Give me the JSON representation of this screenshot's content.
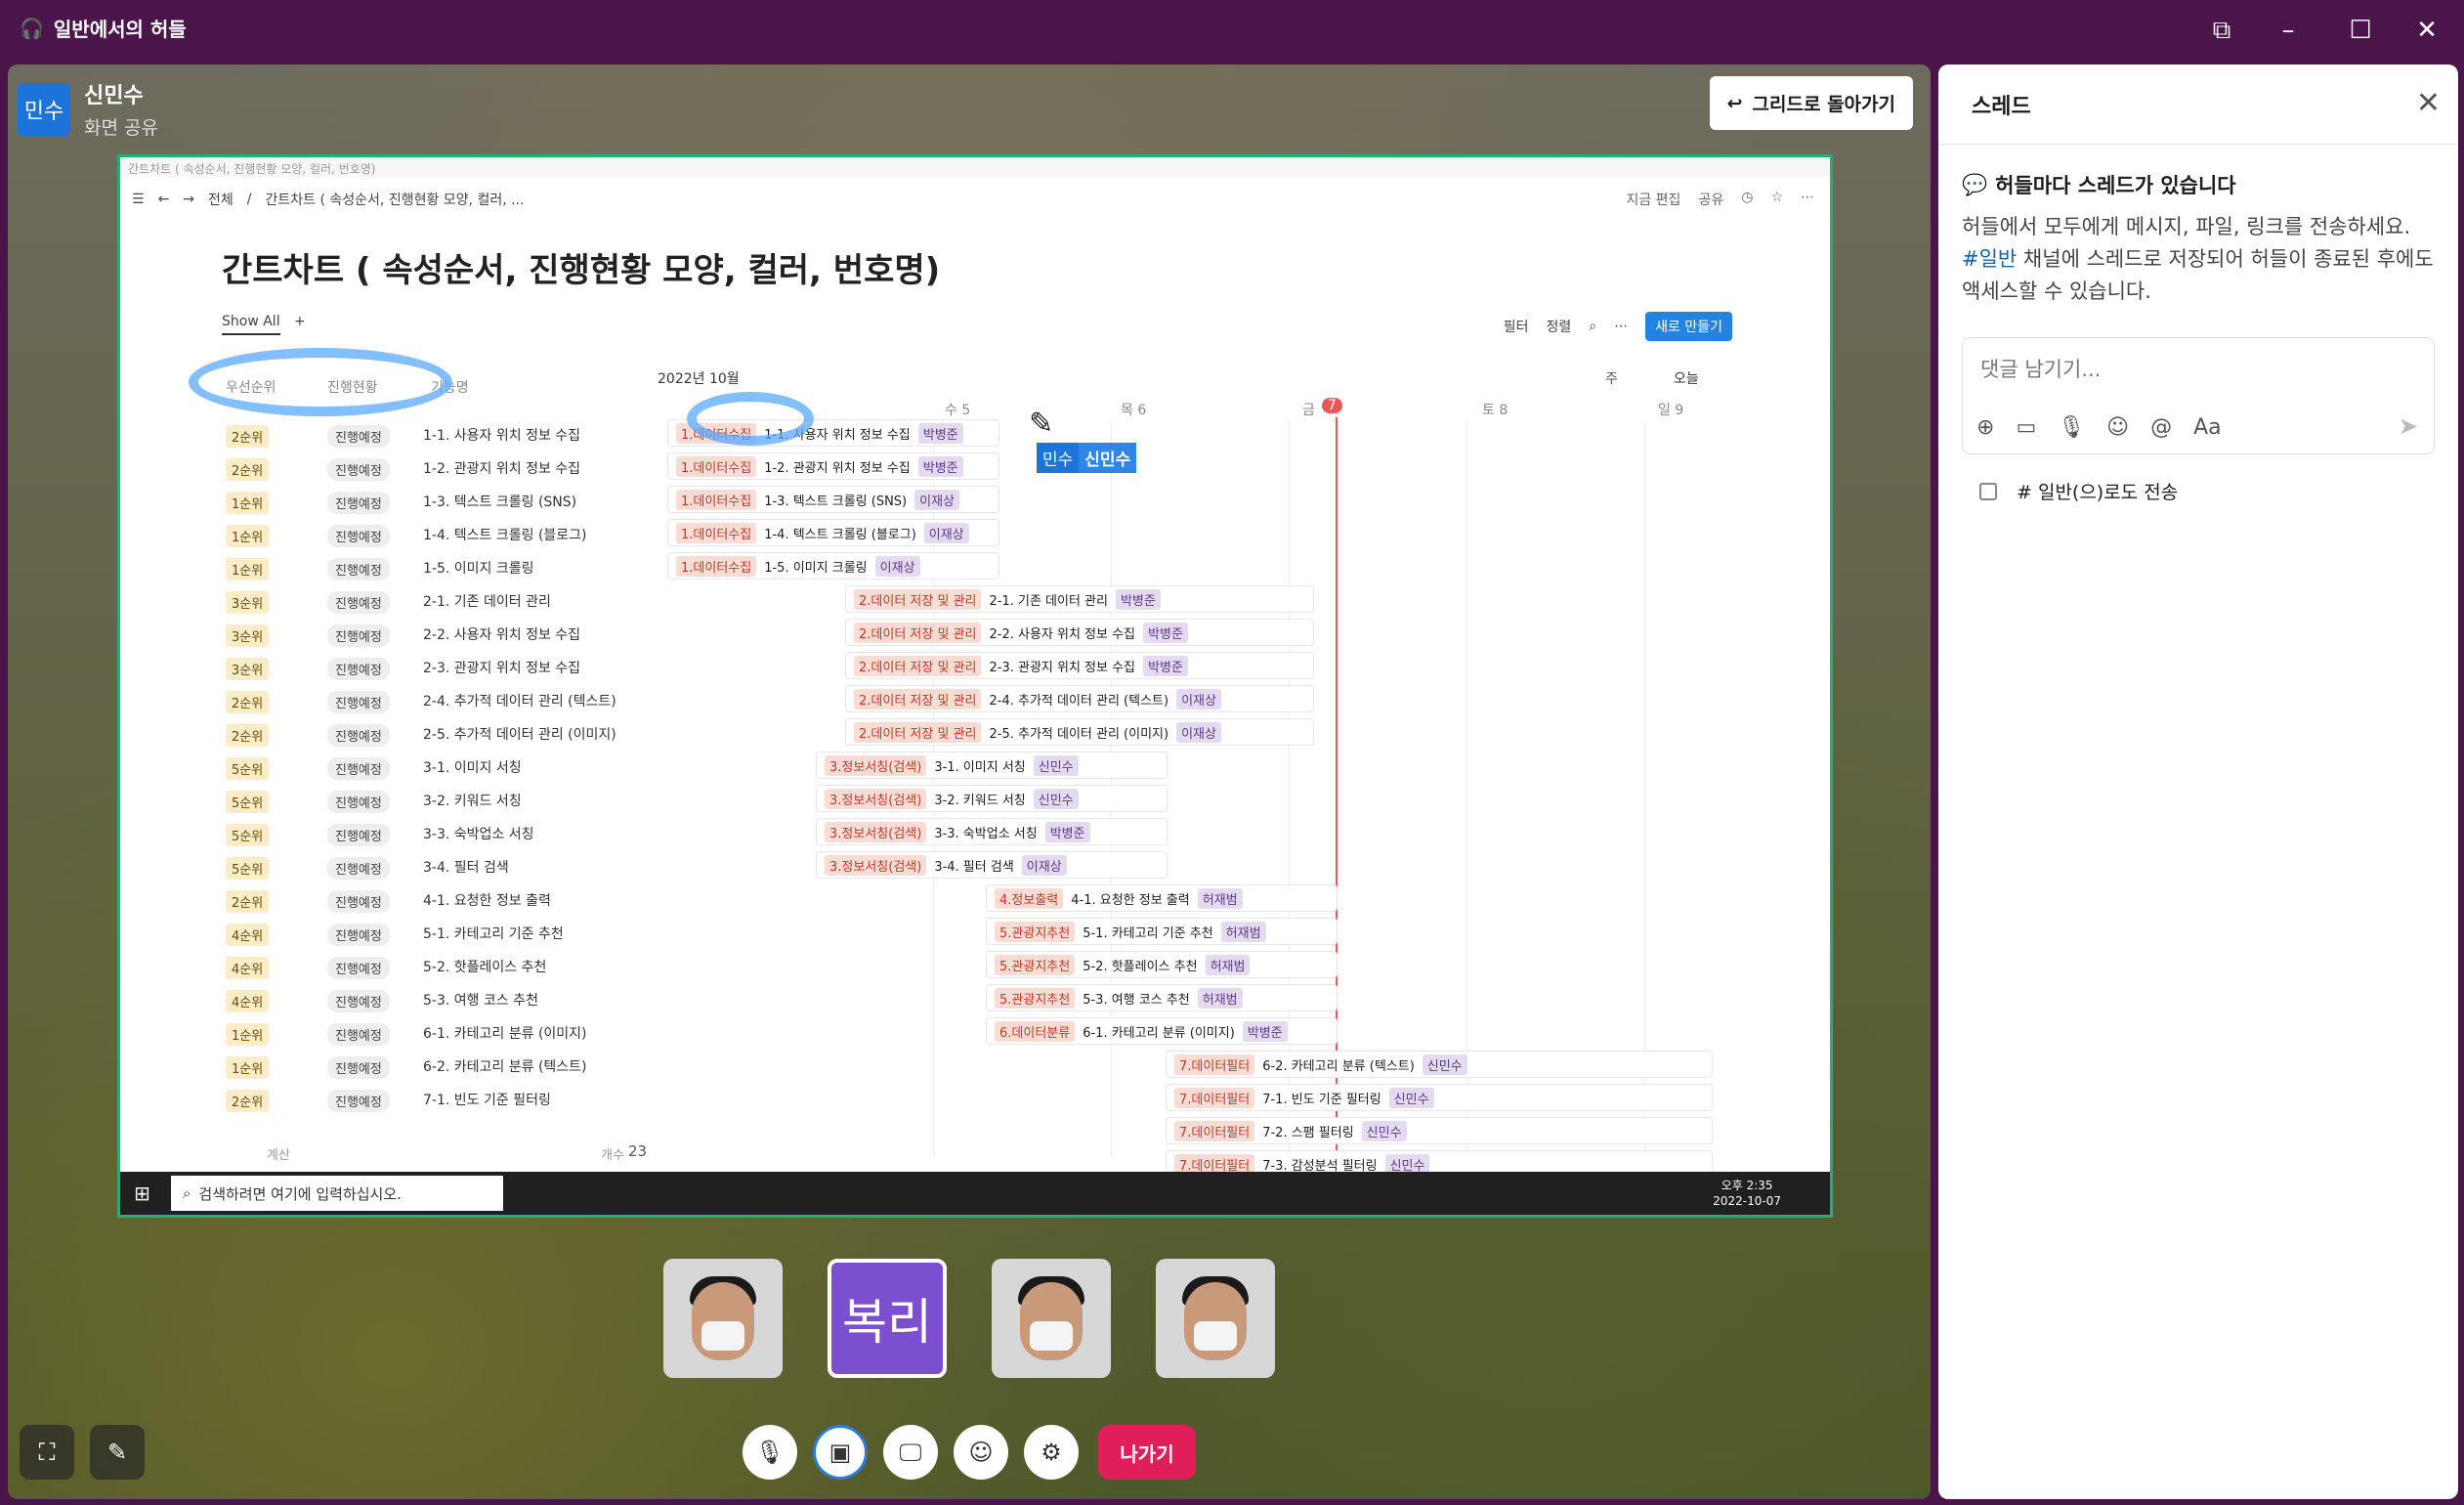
{
  "window": {
    "title": "일반에서의 허들"
  },
  "presenter": {
    "avatar_text": "민수",
    "name": "신민수",
    "status": "화면 공유"
  },
  "back_button": {
    "label": "그리드로 돌아가기"
  },
  "screen": {
    "window_title": "간트차트 ( 속성순서, 진행현황 모양, 컬러, 번호명)",
    "breadcrumb": [
      "전체",
      "간트차트 ( 속성순서, 진행현황 모양, 컬러, ..."
    ],
    "top_actions": [
      "지금 편집",
      "공유"
    ],
    "page_title": "간트차트 ( 속성순서, 진행현황 모양, 컬러, 번호명)",
    "view_tab": "Show All",
    "view_actions": [
      "필터",
      "정렬"
    ],
    "new_button": "새로 만들기",
    "columns": [
      "우선순위",
      "진행현황",
      "기능명"
    ],
    "month": "2022년 10월",
    "nav": {
      "today": "오늘",
      "mode": "주"
    },
    "days": [
      "수 5",
      "목 6",
      "금",
      "토 8",
      "일 9"
    ],
    "today_day": "7",
    "rows": [
      {
        "pri": "2순위",
        "stat": "진행예정",
        "name": "1-1. 사용자 위치 정보 수집",
        "cat": "1.데이터수집",
        "own": "박병준"
      },
      {
        "pri": "2순위",
        "stat": "진행예정",
        "name": "1-2. 관광지 위치 정보 수집",
        "cat": "1.데이터수집",
        "own": "박병준"
      },
      {
        "pri": "1순위",
        "stat": "진행예정",
        "name": "1-3. 텍스트 크롤링 (SNS)",
        "cat": "1.데이터수집",
        "own": "이재상"
      },
      {
        "pri": "1순위",
        "stat": "진행예정",
        "name": "1-4. 텍스트 크롤링 (블로그)",
        "cat": "1.데이터수집",
        "own": "이재상"
      },
      {
        "pri": "1순위",
        "stat": "진행예정",
        "name": "1-5. 이미지 크롤링",
        "cat": "1.데이터수집",
        "own": "이재상"
      },
      {
        "pri": "3순위",
        "stat": "진행예정",
        "name": "2-1. 기존 데이터 관리",
        "cat": "2.데이터 저장 및 관리",
        "own": "박병준"
      },
      {
        "pri": "3순위",
        "stat": "진행예정",
        "name": "2-2. 사용자 위치 정보 수집",
        "cat": "2.데이터 저장 및 관리",
        "own": "박병준"
      },
      {
        "pri": "3순위",
        "stat": "진행예정",
        "name": "2-3. 관광지 위치 정보 수집",
        "cat": "2.데이터 저장 및 관리",
        "own": "박병준"
      },
      {
        "pri": "2순위",
        "stat": "진행예정",
        "name": "2-4. 추가적 데이터 관리 (텍스트)",
        "cat": "2.데이터 저장 및 관리",
        "own": "이재상"
      },
      {
        "pri": "2순위",
        "stat": "진행예정",
        "name": "2-5. 추가적 데이터 관리 (이미지)",
        "cat": "2.데이터 저장 및 관리",
        "own": "이재상"
      },
      {
        "pri": "5순위",
        "stat": "진행예정",
        "name": "3-1. 이미지 서칭",
        "cat": "3.정보서칭(검색)",
        "own": "신민수"
      },
      {
        "pri": "5순위",
        "stat": "진행예정",
        "name": "3-2. 키워드 서칭",
        "cat": "3.정보서칭(검색)",
        "own": "신민수"
      },
      {
        "pri": "5순위",
        "stat": "진행예정",
        "name": "3-3. 숙박업소 서칭",
        "cat": "3.정보서칭(검색)",
        "own": "박병준"
      },
      {
        "pri": "5순위",
        "stat": "진행예정",
        "name": "3-4. 필터 검색",
        "cat": "3.정보서칭(검색)",
        "own": "이재상"
      },
      {
        "pri": "2순위",
        "stat": "진행예정",
        "name": "4-1. 요청한 정보 출력",
        "cat": "4.정보출력",
        "own": "허재범"
      },
      {
        "pri": "4순위",
        "stat": "진행예정",
        "name": "5-1. 카테고리 기준 추천",
        "cat": "5.관광지추천",
        "own": "허재범"
      },
      {
        "pri": "4순위",
        "stat": "진행예정",
        "name": "5-2. 핫플레이스 추천",
        "cat": "5.관광지추천",
        "own": "허재범"
      },
      {
        "pri": "4순위",
        "stat": "진행예정",
        "name": "5-3. 여행 코스 추천",
        "cat": "5.관광지추천",
        "own": "허재범"
      },
      {
        "pri": "1순위",
        "stat": "진행예정",
        "name": "6-1. 카테고리 분류 (이미지)",
        "cat": "6.데이터분류",
        "own": "박병준"
      },
      {
        "pri": "1순위",
        "stat": "진행예정",
        "name": "6-2. 카테고리 분류 (텍스트)",
        "cat": "7.데이터필터",
        "own": "신민수"
      },
      {
        "pri": "2순위",
        "stat": "진행예정",
        "name": "7-1. 빈도 기준 필터링",
        "cat": "7.데이터필터",
        "own": "신민수"
      }
    ],
    "extra_bars": [
      {
        "cat": "7.데이터필터",
        "name": "7-2. 스팸 필터링",
        "own": "신민수"
      },
      {
        "cat": "7.데이터필터",
        "name": "7-3. 감성분석 필터링",
        "own": "신민수"
      }
    ],
    "footer": {
      "calc": "계산",
      "count_label": "개수",
      "count": "23"
    },
    "cursor": {
      "tag": "민수",
      "name": "신민수"
    },
    "taskbar": {
      "search": "검색하려면 여기에 입력하십시오.",
      "time": "오후 2:35",
      "date": "2022-10-07"
    }
  },
  "tiles": [
    {
      "type": "video"
    },
    {
      "type": "text",
      "label": "복리"
    },
    {
      "type": "video"
    },
    {
      "type": "video"
    }
  ],
  "leave_button": "나가기",
  "thread": {
    "title": "스레드",
    "info_title": "허들마다 스레드가 있습니다",
    "info_desc_1": "허들에서 모두에게 메시지, 파일, 링크를 전송하세요.",
    "channel": "#일반",
    "info_desc_2": " 채널에 스레드로 저장되어 허들이 종료된 후에도 액세스할 수 있습니다.",
    "placeholder": "댓글 남기기...",
    "format_label": "Aa",
    "also_send": "# 일반(으)로도 전송"
  }
}
